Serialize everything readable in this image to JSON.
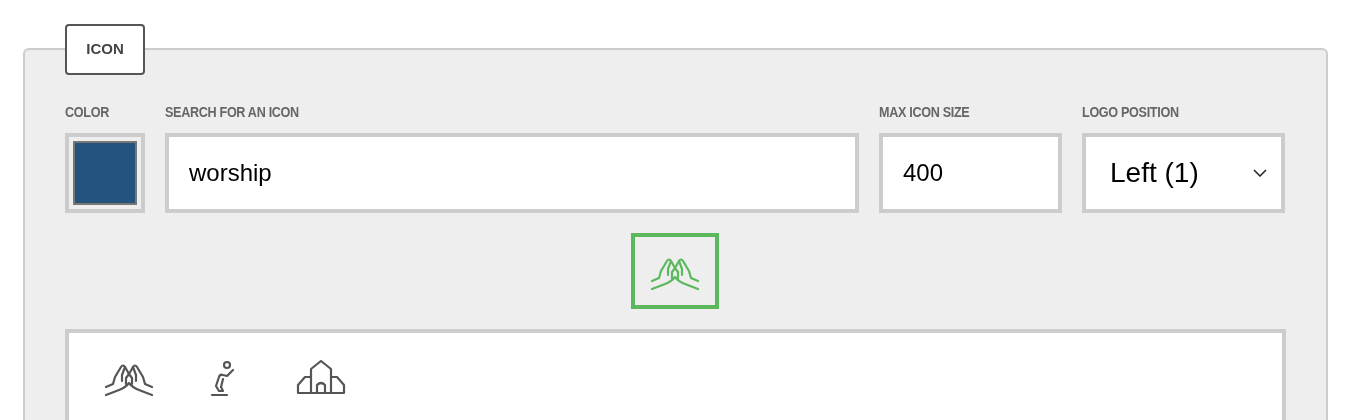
{
  "panel": {
    "legend": "ICON"
  },
  "color": {
    "label": "COLOR",
    "color": "#23537e"
  },
  "search": {
    "label": "SEARCH FOR AN ICON",
    "value": "worship"
  },
  "max_size": {
    "label": "MAX ICON SIZE",
    "value": "400"
  },
  "logo_position": {
    "label": "LOGO POSITION",
    "value": "Left (1)"
  },
  "preview": {
    "kind": "hands"
  },
  "results": [
    {
      "kind": "hands"
    },
    {
      "kind": "kneeling"
    },
    {
      "kind": "church"
    }
  ]
}
